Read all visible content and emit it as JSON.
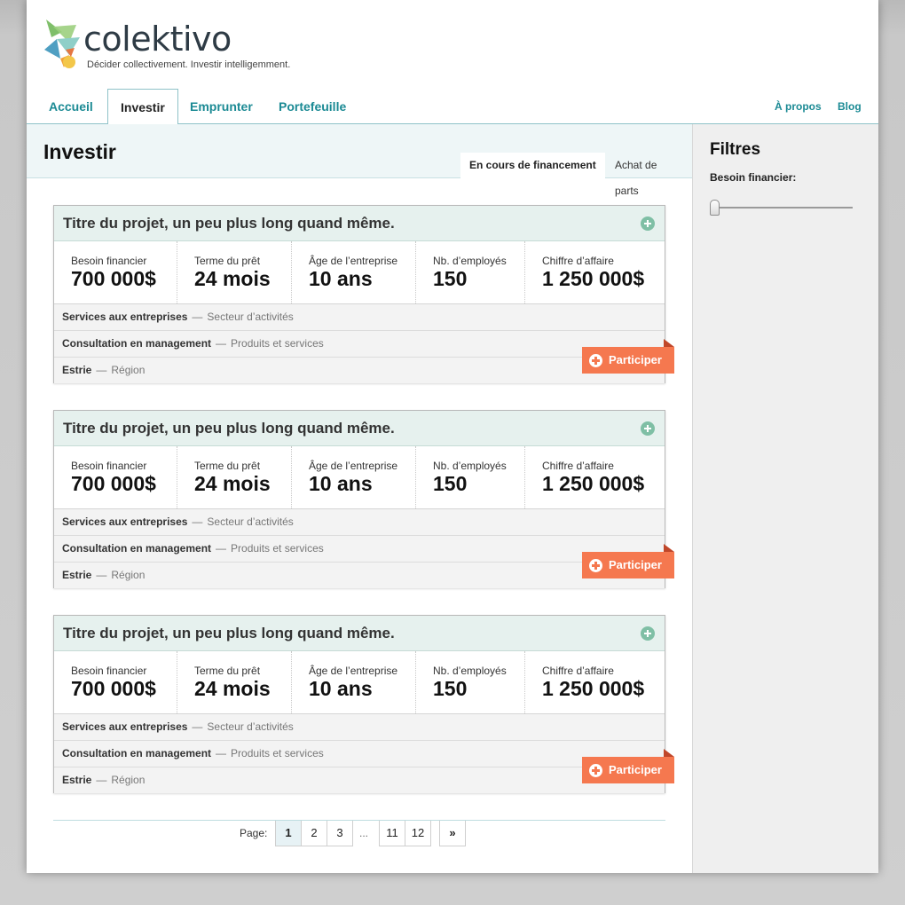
{
  "brand": {
    "name": "colektivo",
    "tagline": "Décider collectivement. Investir intelligemment."
  },
  "nav": {
    "items": [
      "Accueil",
      "Investir",
      "Emprunter",
      "Portefeuille"
    ],
    "active": "Investir",
    "right": [
      "À propos",
      "Blog"
    ]
  },
  "content": {
    "title": "Investir",
    "subtabs": [
      "En cours de financement",
      "Achat de parts"
    ],
    "active_subtab": "En cours de financement"
  },
  "sidebar": {
    "title": "Filtres",
    "filter_label": "Besoin financier:"
  },
  "projects": [
    {
      "title": "Titre du projet, un peu plus long quand même.",
      "stats": [
        {
          "label": "Besoin financier",
          "value": "700 000$"
        },
        {
          "label": "Terme du prêt",
          "value": "24 mois"
        },
        {
          "label": "Âge de l’entreprise",
          "value": "10 ans"
        },
        {
          "label": "Nb. d’employés",
          "value": "150"
        },
        {
          "label": "Chiffre d’affaire",
          "value": "1 250 000$"
        }
      ],
      "rows": [
        {
          "value": "Services aux entreprises",
          "category": "Secteur d’activités"
        },
        {
          "value": "Consultation en management",
          "category": "Produits et services"
        },
        {
          "value": "Estrie",
          "category": "Région"
        }
      ],
      "cta": "Participer"
    },
    {
      "title": "Titre du projet, un peu plus long quand même.",
      "stats": [
        {
          "label": "Besoin financier",
          "value": "700 000$"
        },
        {
          "label": "Terme du prêt",
          "value": "24 mois"
        },
        {
          "label": "Âge de l’entreprise",
          "value": "10 ans"
        },
        {
          "label": "Nb. d’employés",
          "value": "150"
        },
        {
          "label": "Chiffre d’affaire",
          "value": "1 250 000$"
        }
      ],
      "rows": [
        {
          "value": "Services aux entreprises",
          "category": "Secteur d’activités"
        },
        {
          "value": "Consultation en management",
          "category": "Produits et services"
        },
        {
          "value": "Estrie",
          "category": "Région"
        }
      ],
      "cta": "Participer"
    },
    {
      "title": "Titre du projet, un peu plus long quand même.",
      "stats": [
        {
          "label": "Besoin financier",
          "value": "700 000$"
        },
        {
          "label": "Terme du prêt",
          "value": "24 mois"
        },
        {
          "label": "Âge de l’entreprise",
          "value": "10 ans"
        },
        {
          "label": "Nb. d’employés",
          "value": "150"
        },
        {
          "label": "Chiffre d’affaire",
          "value": "1 250 000$"
        }
      ],
      "rows": [
        {
          "value": "Services aux entreprises",
          "category": "Secteur d’activités"
        },
        {
          "value": "Consultation en management",
          "category": "Produits et services"
        },
        {
          "value": "Estrie",
          "category": "Région"
        }
      ],
      "cta": "Participer"
    }
  ],
  "pagination": {
    "label": "Page:",
    "pages": [
      "1",
      "2",
      "3",
      "11",
      "12"
    ],
    "current": "1",
    "ellipsis": "...",
    "next": "»"
  },
  "colors": {
    "accent": "#1b8a94",
    "cta": "#f5784f",
    "card_header": "#e6f1ee"
  }
}
